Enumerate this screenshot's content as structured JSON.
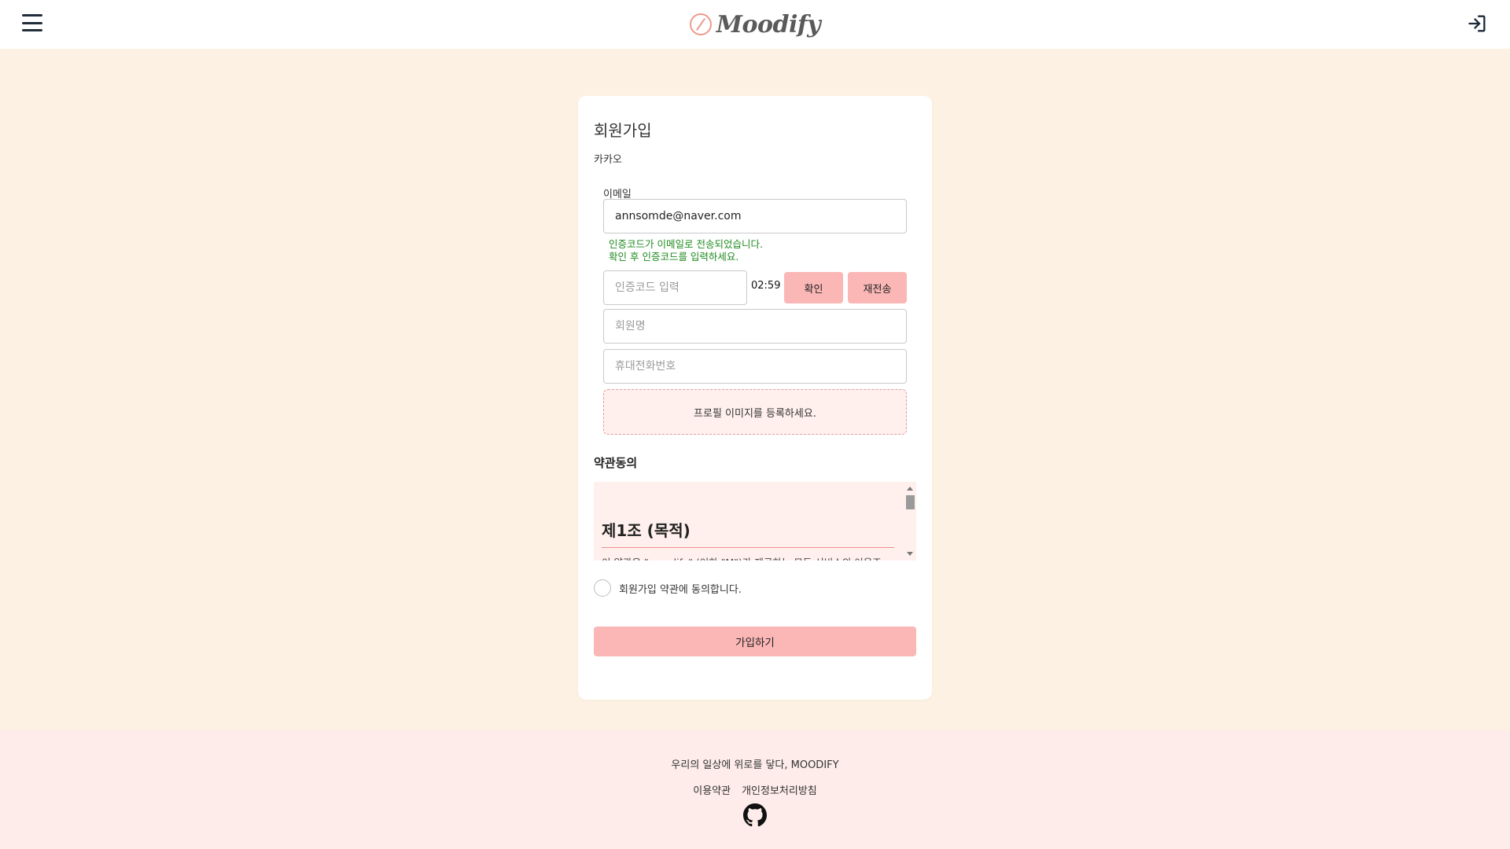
{
  "header": {
    "logo_text": "Moodify"
  },
  "signup": {
    "title": "회원가입",
    "provider": "카카오",
    "email_label": "이메일",
    "email_value": "annsomde@naver.com",
    "verify_message_line1": "인증코드가 이메일로 전송되었습니다.",
    "verify_message_line2": "확인 후 인증코드를 입력하세요.",
    "code_placeholder": "인증코드 입력",
    "timer": "02:59",
    "confirm_label": "확인",
    "resend_label": "재전송",
    "name_placeholder": "회원명",
    "phone_placeholder": "휴대전화번호",
    "profile_upload_label": "프로필 이미지를 등록하세요.",
    "terms_title": "약관동의",
    "terms_heading": "제1조 (목적)",
    "terms_text": "이 약관은 \"moodify\" (이하 \"M\")가 제공하는 모든 서비스의 이용조",
    "agree_label": "회원가입 약관에 동의합니다.",
    "submit_label": "가입하기"
  },
  "footer": {
    "slogan": "우리의 일상에 위로를 닿다, MOODIFY",
    "links": [
      "이용약관",
      "개인정보처리방침"
    ]
  },
  "icons": {
    "menu": "hamburger-menu-icon",
    "login": "login-icon",
    "github": "github-icon"
  },
  "colors": {
    "background": "#fdf1e4",
    "accent_pink": "#fbb6b6",
    "success_green": "#1f8a1f",
    "footer_bg": "#fdece9"
  }
}
